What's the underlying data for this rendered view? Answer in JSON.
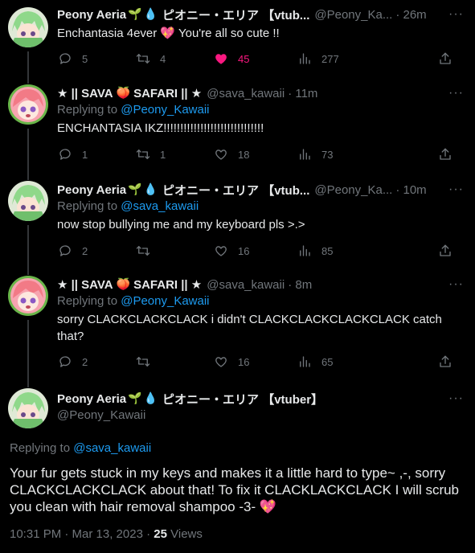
{
  "colors": {
    "background": "#000000",
    "text": "#e7e9ea",
    "muted": "#71767b",
    "link": "#1d9bf0",
    "like": "#f91880",
    "divider": "#2f3336"
  },
  "tweets": [
    {
      "name": "Peony Aeria",
      "name_suffix": "ピオニー・エリア 【vtub...",
      "emojis": [
        "seedling-emoji",
        "droplet-emoji"
      ],
      "handle": "@Peony_Ka...",
      "time": "· 26m",
      "replying_to_label": "",
      "replying_to_handle": "",
      "text": "Enchantasia 4ever 💖 You're all so cute !!",
      "replies": "5",
      "reposts": "4",
      "likes": "45",
      "views": "277",
      "liked": true
    },
    {
      "name": "★ || SAVA",
      "name_suffix": "SAFARI || ★",
      "emojis": [
        "peach-emoji"
      ],
      "handle": "@sava_kawaii",
      "time": "· 11m",
      "replying_to_label": "Replying to",
      "replying_to_handle": "@Peony_Kawaii",
      "text": "ENCHANTASIA IKZ!!!!!!!!!!!!!!!!!!!!!!!!!!!!!!",
      "replies": "1",
      "reposts": "1",
      "likes": "18",
      "views": "73",
      "liked": false
    },
    {
      "name": "Peony Aeria",
      "name_suffix": "ピオニー・エリア 【vtub...",
      "emojis": [
        "seedling-emoji",
        "droplet-emoji"
      ],
      "handle": "@Peony_Ka...",
      "time": "· 10m",
      "replying_to_label": "Replying to",
      "replying_to_handle": "@sava_kawaii",
      "text": "now stop bullying me and my keyboard pls >.>",
      "replies": "2",
      "reposts": "",
      "likes": "16",
      "views": "85",
      "liked": false
    },
    {
      "name": "★ || SAVA",
      "name_suffix": "SAFARI || ★",
      "emojis": [
        "peach-emoji"
      ],
      "handle": "@sava_kawaii",
      "time": "· 8m",
      "replying_to_label": "Replying to",
      "replying_to_handle": "@Peony_Kawaii",
      "text": "sorry CLACKCLACKCLACK i didn't CLACKCLACKCLACKCLACK catch that?",
      "replies": "2",
      "reposts": "",
      "likes": "16",
      "views": "65",
      "liked": false
    }
  ],
  "focused": {
    "name": "Peony Aeria",
    "name_suffix": "ピオニー・エリア 【vtuber】",
    "handle": "@Peony_Kawaii",
    "replying_to_label": "Replying to",
    "replying_to_handle": "@sava_kawaii",
    "text": "Your fur gets stuck in my keys and makes it a little hard to type~ ,-, sorry CLACKCLACKCLACK about that! To fix it CLACKLACKCLACK I will scrub you clean with hair removal shampoo -3- 💖",
    "timestamp": "10:31 PM · Mar 13, 2023 ·",
    "views_count": "25",
    "views_label": "Views"
  },
  "icons": {
    "more": "more-dots-icon",
    "reply": "reply-bubble-icon",
    "repost": "repost-icon",
    "like": "heart-icon",
    "views": "views-bars-icon",
    "share": "share-icon"
  }
}
